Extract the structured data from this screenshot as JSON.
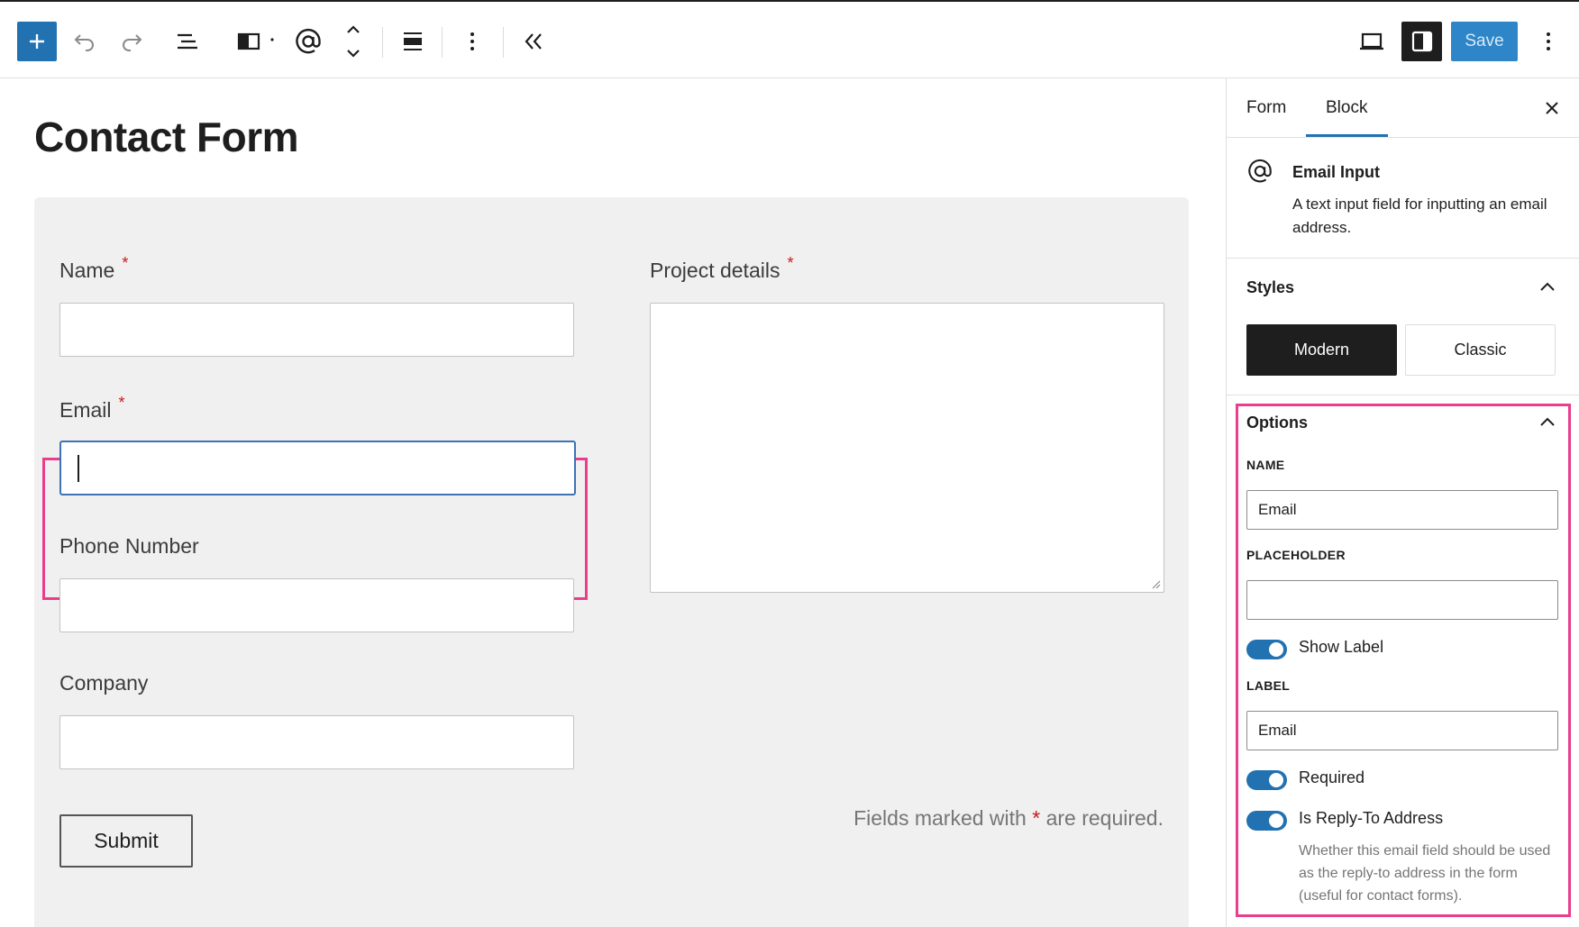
{
  "toolbar": {
    "save_label": "Save"
  },
  "page": {
    "title": "Contact Form"
  },
  "form": {
    "fields": {
      "name": {
        "label": "Name",
        "required_mark": "*"
      },
      "email": {
        "label": "Email",
        "required_mark": "*"
      },
      "phone": {
        "label": "Phone Number"
      },
      "company": {
        "label": "Company"
      },
      "project": {
        "label": "Project details",
        "required_mark": "*"
      }
    },
    "submit_label": "Submit",
    "required_note_prefix": "Fields marked with",
    "required_note_star": "*",
    "required_note_suffix": "are required."
  },
  "sidebar": {
    "tabs": [
      {
        "label": "Form",
        "active": false
      },
      {
        "label": "Block",
        "active": true
      }
    ],
    "block": {
      "title": "Email Input",
      "description": "A text input field for inputting an email address."
    },
    "styles": {
      "heading": "Styles",
      "options": [
        "Modern",
        "Classic"
      ],
      "selected": "Modern"
    },
    "options": {
      "heading": "Options",
      "name_label": "NAME",
      "name_value": "Email",
      "placeholder_label": "PLACEHOLDER",
      "placeholder_value": "",
      "show_label_toggle": "Show Label",
      "label_label": "LABEL",
      "label_value": "Email",
      "required_toggle": "Required",
      "reply_to_toggle": "Is Reply-To Address",
      "reply_to_help": "Whether this email field should be used as the reply-to address in the form (useful for contact forms)."
    }
  },
  "colors": {
    "accent": "#2271b1",
    "highlight": "#e83e8c",
    "required": "#cc1818"
  }
}
